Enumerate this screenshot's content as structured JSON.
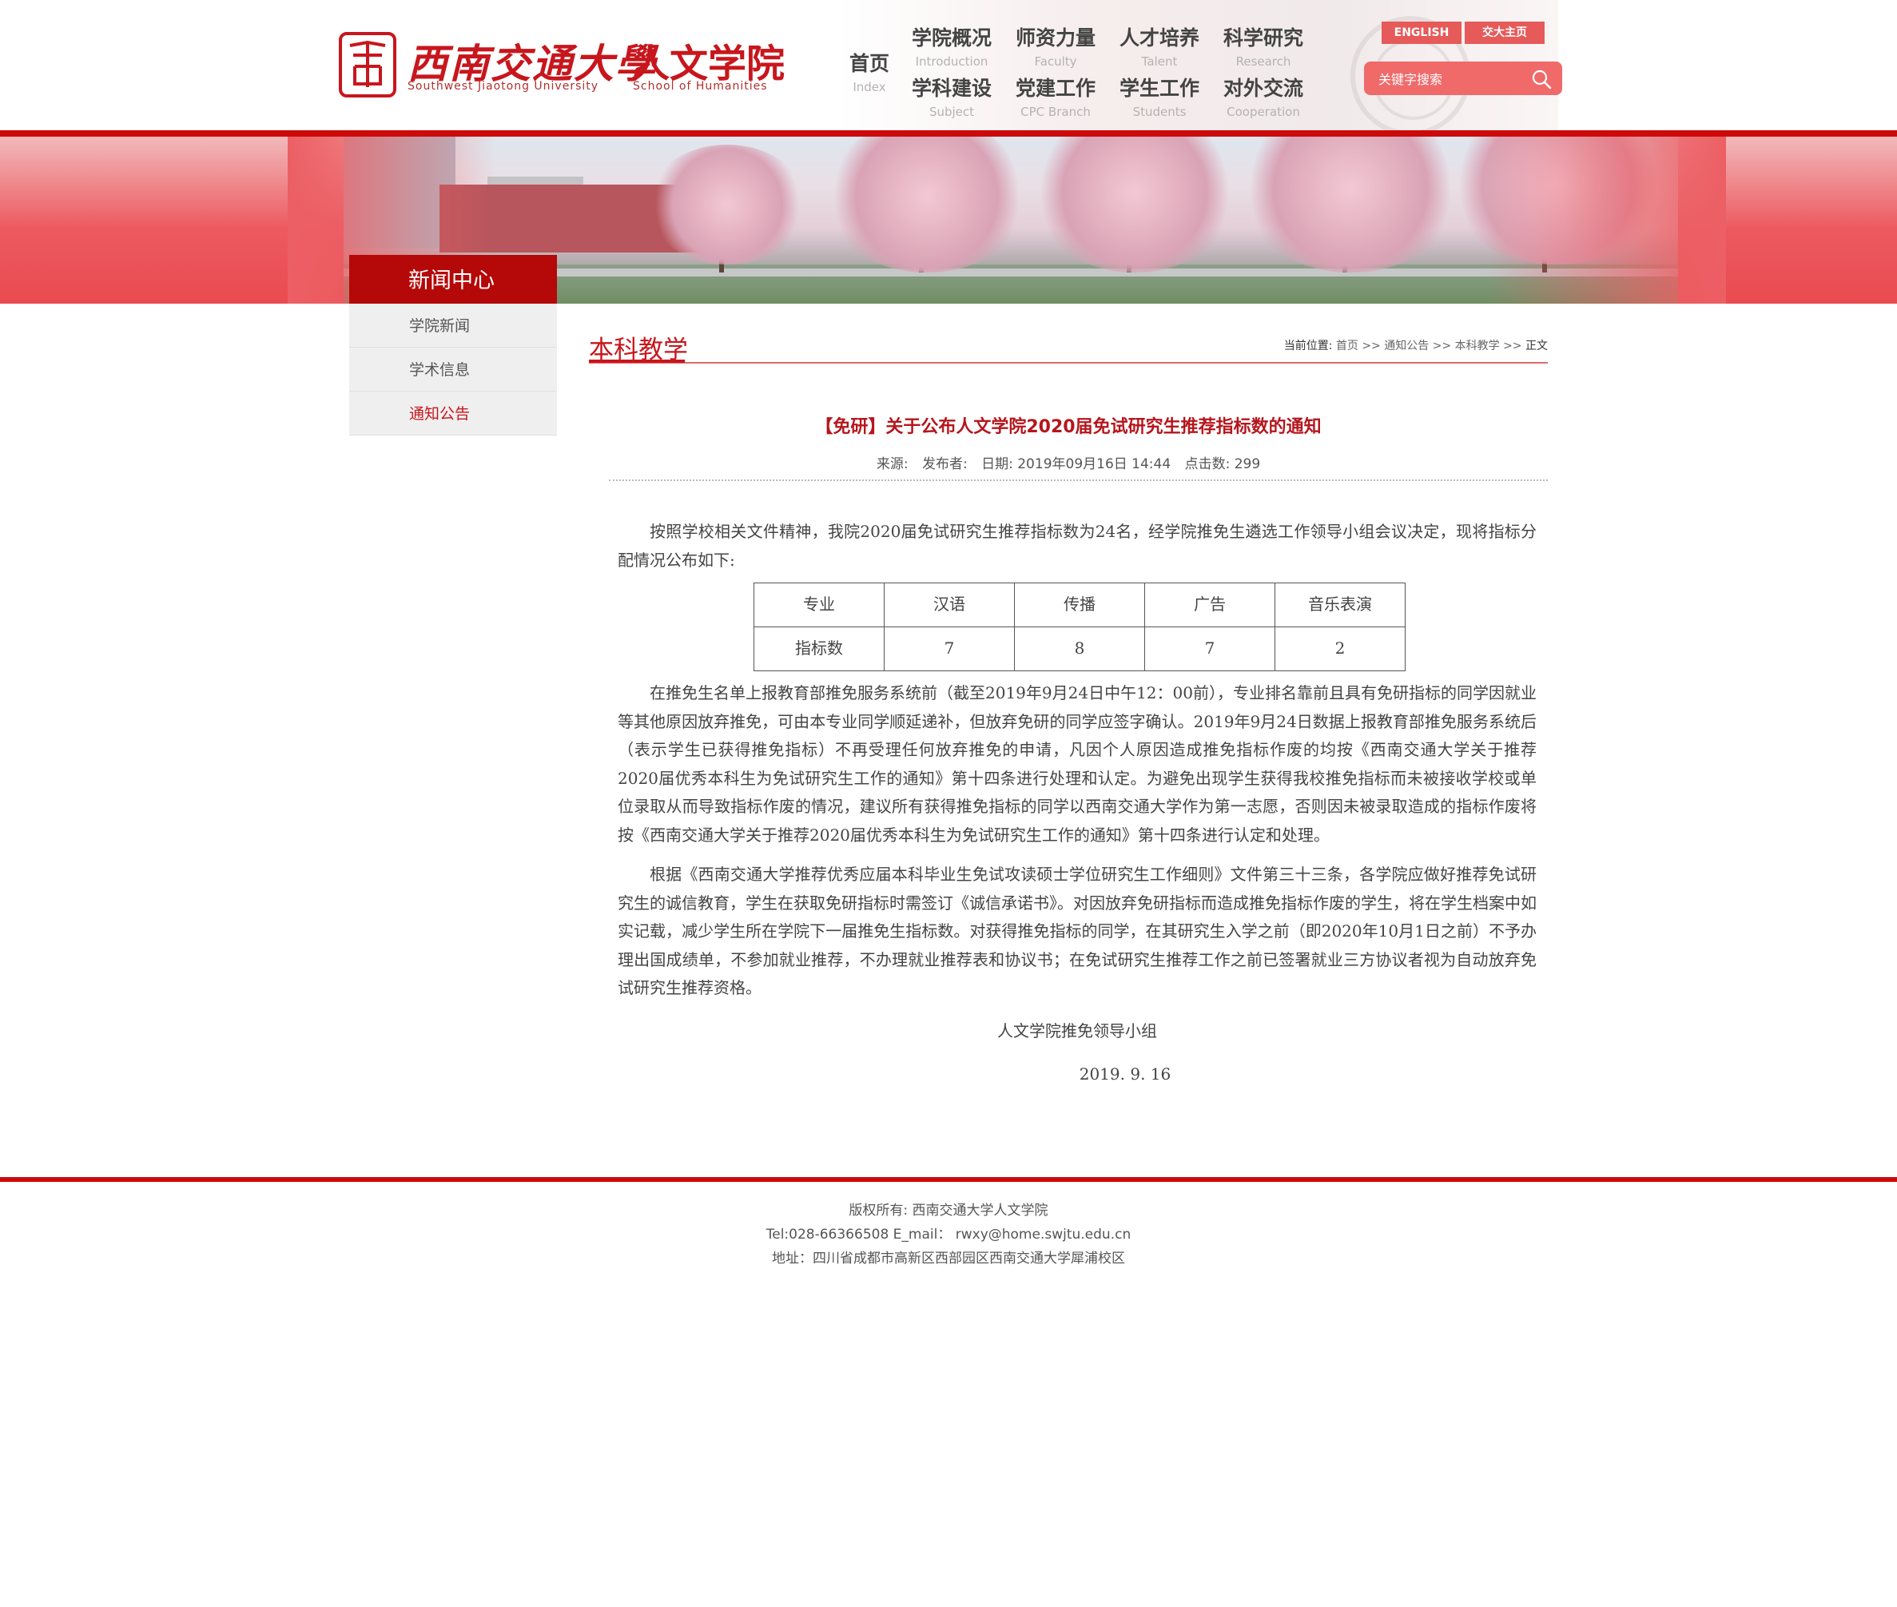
{
  "header": {
    "logo_cn": "西南交通大學",
    "logo_dept": "人文学院",
    "logo_en": "Southwest Jiaotong University",
    "logo_dept_en": "School of Humanities",
    "nav_home": {
      "cn": "首页",
      "en": "Index"
    },
    "nav": [
      {
        "cn": "学院概况",
        "en": "Introduction"
      },
      {
        "cn": "师资力量",
        "en": "Faculty"
      },
      {
        "cn": "人才培养",
        "en": "Talent"
      },
      {
        "cn": "科学研究",
        "en": "Research"
      },
      {
        "cn": "学科建设",
        "en": "Subject"
      },
      {
        "cn": "党建工作",
        "en": "CPC Branch"
      },
      {
        "cn": "学生工作",
        "en": "Students"
      },
      {
        "cn": "对外交流",
        "en": "Cooperation"
      }
    ],
    "english_label": "ENGLISH",
    "jiaoda_home_label": "交大主页",
    "search_placeholder": "关键字搜索"
  },
  "sidebar": {
    "title": "新闻中心",
    "items": [
      {
        "label": "学院新闻",
        "active": false
      },
      {
        "label": "学术信息",
        "active": false
      },
      {
        "label": "通知公告",
        "active": true
      }
    ]
  },
  "content": {
    "section_title": "本科教学",
    "breadcrumb": {
      "label": "当前位置:",
      "items": [
        "首页",
        "通知公告",
        "本科教学",
        "正文"
      ],
      "separator": ">>"
    },
    "article": {
      "title": "【免研】关于公布人文学院2020届免试研究生推荐指标数的通知",
      "meta": {
        "source": "来源:",
        "publisher": "发布者:",
        "date": "日期: 2019年09月16日 14:44",
        "hits": "点击数: 299"
      },
      "intro": "按照学校相关文件精神，我院2020届免试研究生推荐指标数为24名，经学院推免生遴选工作领导小组会议决定，现将指标分配情况公布如下:",
      "table": {
        "header": [
          "专业",
          "汉语",
          "传播",
          "广告",
          "音乐表演"
        ],
        "row": [
          "指标数",
          "7",
          "8",
          "7",
          "2"
        ]
      },
      "para2": "在推免生名单上报教育部推免服务系统前（截至2019年9月24日中午12：00前），专业排名靠前且具有免研指标的同学因就业等其他原因放弃推免，可由本专业同学顺延递补，但放弃免研的同学应签字确认。2019年9月24日数据上报教育部推免服务系统后（表示学生已获得推免指标）不再受理任何放弃推免的申请，凡因个人原因造成推免指标作废的均按《西南交通大学关于推荐2020届优秀本科生为免试研究生工作的通知》第十四条进行处理和认定。为避免出现学生获得我校推免指标而未被接收学校或单位录取从而导致指标作废的情况，建议所有获得推免指标的同学以西南交通大学作为第一志愿，否则因未被录取造成的指标作废将按《西南交通大学关于推荐2020届优秀本科生为免试研究生工作的通知》第十四条进行认定和处理。",
      "para3": "根据《西南交通大学推荐优秀应届本科毕业生免试攻读硕士学位研究生工作细则》文件第三十三条，各学院应做好推荐免试研究生的诚信教育，学生在获取免研指标时需签订《诚信承诺书》。对因放弃免研指标而造成推免指标作废的学生，将在学生档案中如实记载，减少学生所在学院下一届推免生指标数。对获得推免指标的同学，在其研究生入学之前（即2020年10月1日之前）不予办理出国成绩单，不参加就业推荐，不办理就业推荐表和协议书；在免试研究生推荐工作之前已签署就业三方协议者视为自动放弃免试研究生推荐资格。",
      "signature": "人文学院推免领导小组",
      "sign_date": "2019. 9. 16"
    }
  },
  "footer": {
    "copyright": "版权所有: 西南交通大学人文学院",
    "contact": "Tel:028-66366508 E_mail： rwxy@home.swjtu.edu.cn",
    "address": "地址：四川省成都市高新区西部园区西南交通大学犀浦校区"
  },
  "colors": {
    "brand_red": "#c8161d",
    "header_line": "#cc0a0a",
    "button_red": "#e65a5a"
  }
}
